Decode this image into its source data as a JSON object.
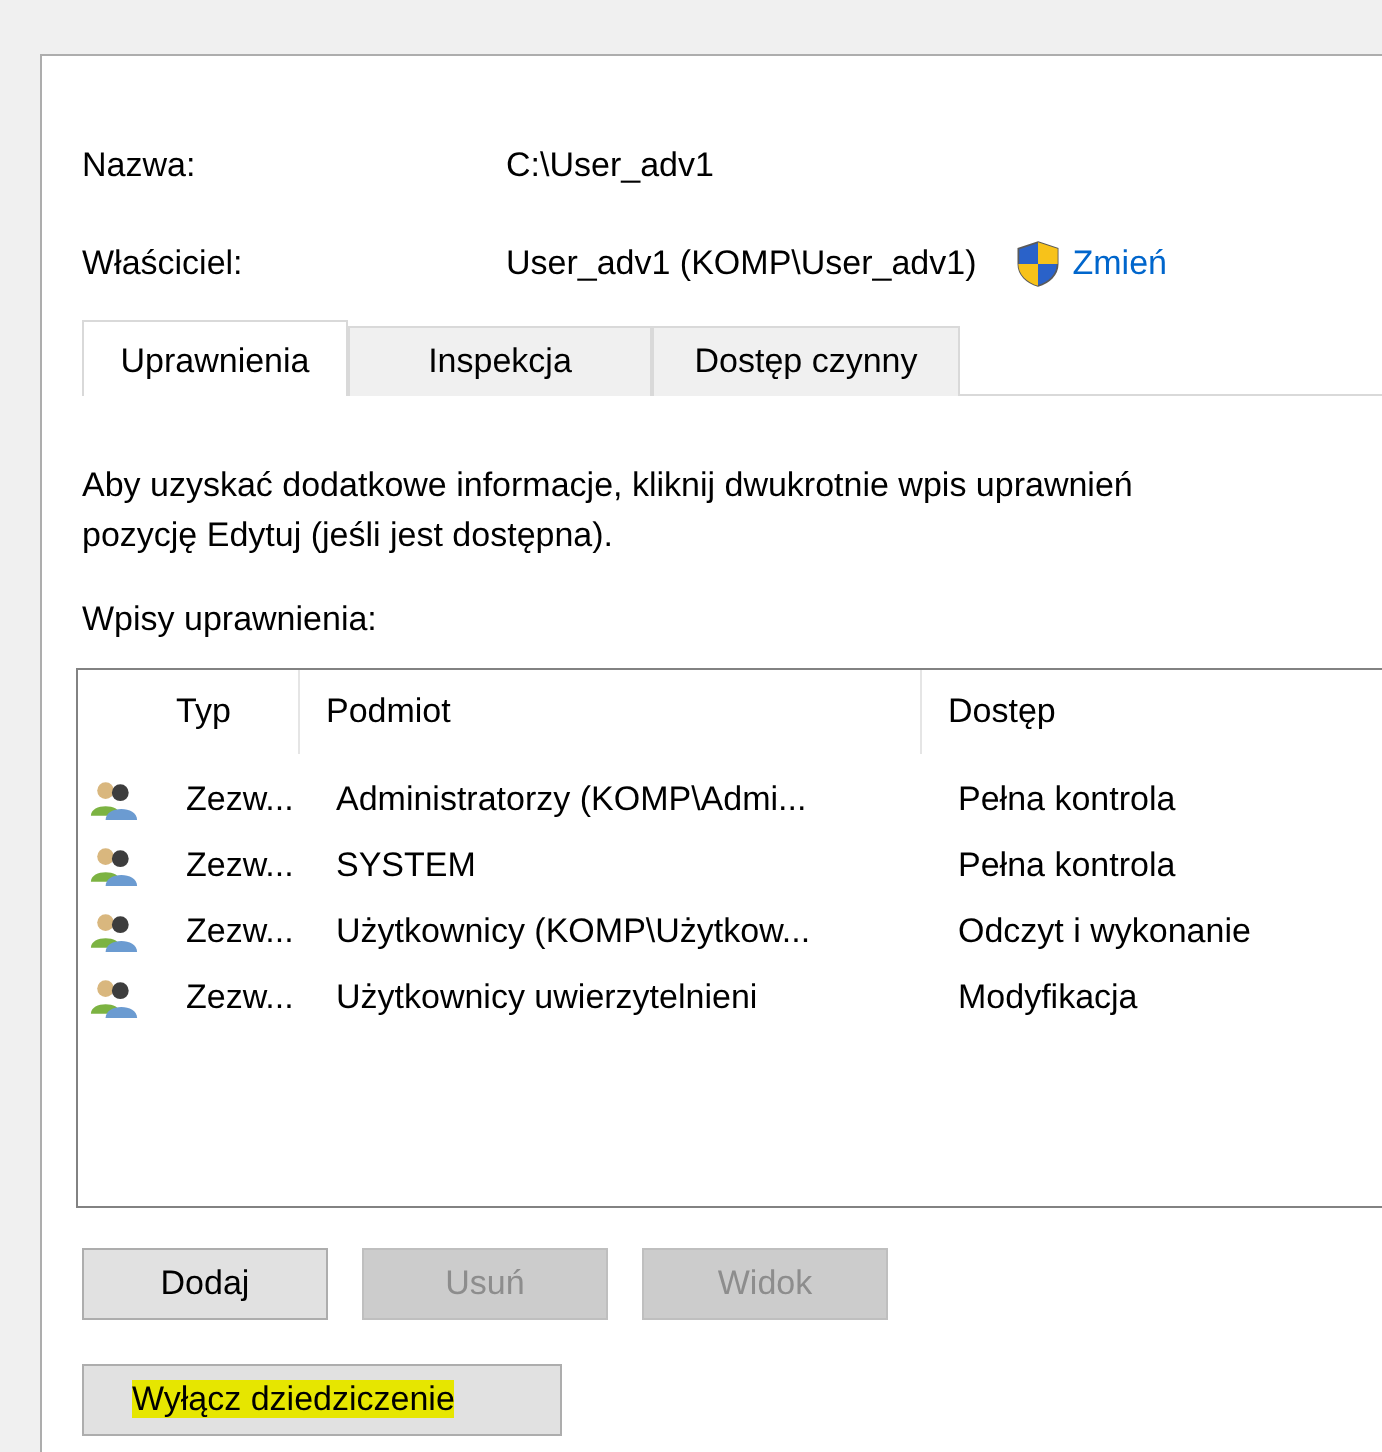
{
  "fields": [
    {
      "label": "Nazwa:",
      "value": "C:\\User_adv1"
    },
    {
      "label": "Właściciel:",
      "value": "User_adv1 (KOMP\\User_adv1)",
      "link": "Zmień"
    }
  ],
  "tabs": [
    {
      "label": "Uprawnienia",
      "selected": true
    },
    {
      "label": "Inspekcja",
      "selected": false
    },
    {
      "label": "Dostęp czynny",
      "selected": false
    }
  ],
  "description": [
    "Aby uzyskać dodatkowe informacje, kliknij dwukrotnie wpis uprawnień",
    "pozycję Edytuj (jeśli jest dostępna)."
  ],
  "list_label": "Wpisy uprawnienia:",
  "table": {
    "columns": [
      "Typ",
      "Podmiot",
      "Dostęp"
    ],
    "rows": [
      {
        "cells": [
          "Zezw...",
          "Administratorzy (KOMP\\Admi...",
          "Pełna kontrola"
        ]
      },
      {
        "cells": [
          "Zezw...",
          "SYSTEM",
          "Pełna kontrola"
        ]
      },
      {
        "cells": [
          "Zezw...",
          "Użytkownicy (KOMP\\Użytkow...",
          "Odczyt i wykonanie"
        ]
      },
      {
        "cells": [
          "Zezw...",
          "Użytkownicy uwierzytelnieni",
          "Modyfikacja"
        ]
      }
    ]
  },
  "buttons": [
    {
      "label": "Dodaj",
      "disabled": false
    },
    {
      "label": "Usuń",
      "disabled": true
    },
    {
      "label": "Widok",
      "disabled": true
    }
  ],
  "inherit_button": {
    "label": "Wyłącz dziedziczenie",
    "highlighted": true
  }
}
